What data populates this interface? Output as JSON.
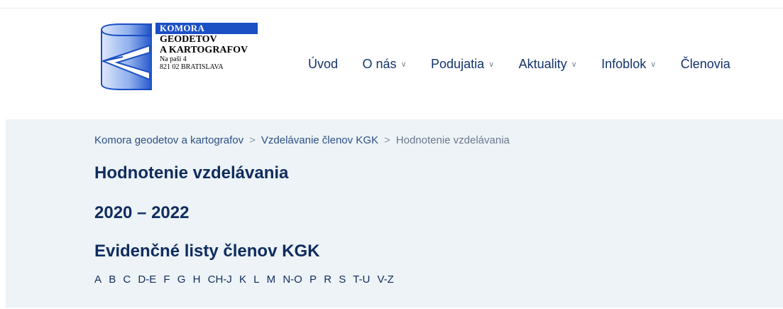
{
  "logo": {
    "komora": "KOMORA",
    "line1": "GEODETOV",
    "line2": "A KARTOGRAFOV",
    "address1": "Na paši 4",
    "address2": "821 02 BRATISLAVA"
  },
  "nav": {
    "items": [
      {
        "label": "Úvod",
        "has_dropdown": false
      },
      {
        "label": "O nás",
        "has_dropdown": true
      },
      {
        "label": "Podujatia",
        "has_dropdown": true
      },
      {
        "label": "Aktuality",
        "has_dropdown": true
      },
      {
        "label": "Infoblok",
        "has_dropdown": true
      },
      {
        "label": "Členovia",
        "has_dropdown": false
      }
    ]
  },
  "breadcrumb": {
    "items": [
      "Komora geodetov a kartografov",
      "Vzdelávanie členov KGK",
      "Hodnotenie vzdelávania"
    ],
    "separator": ">"
  },
  "page": {
    "title": "Hodnotenie vzdelávania",
    "years": "2020 – 2022",
    "subtitle": "Evidenčné listy členov KGK"
  },
  "letters": [
    "A",
    "B",
    "C",
    "D-E",
    "F",
    "G",
    "H",
    "CH-J",
    "K",
    "L",
    "M",
    "N-O",
    "P",
    "R",
    "S",
    "T-U",
    "V-Z"
  ],
  "colors": {
    "brand_blue": "#1b4fc4",
    "heading": "#0f2c5e",
    "panel_bg": "#edf3f6"
  }
}
